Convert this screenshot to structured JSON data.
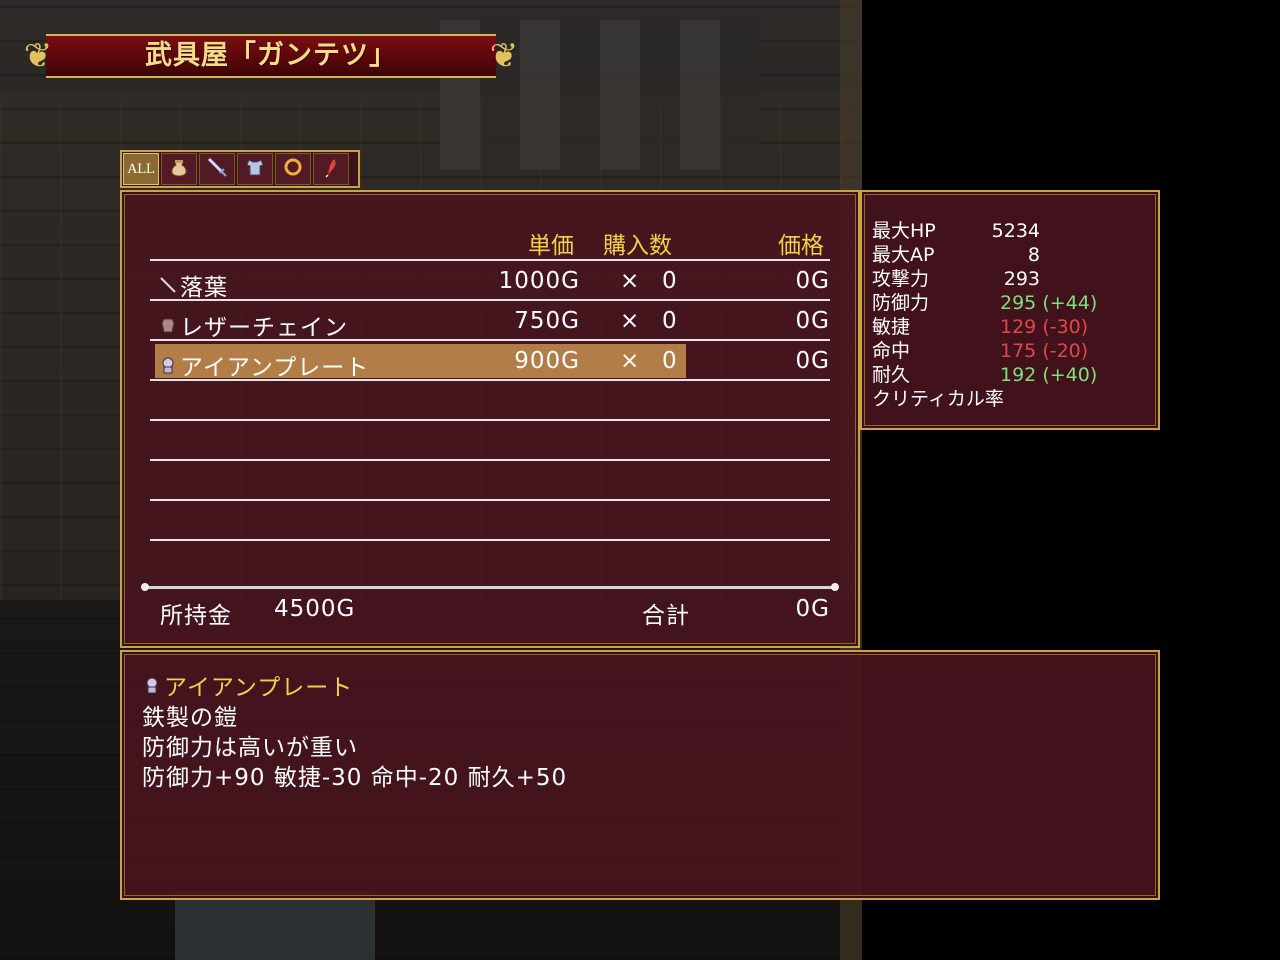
{
  "shop_title": "武具屋「ガンテツ」",
  "tabs": [
    {
      "label": "ALL",
      "icon": "all-text",
      "active": true
    },
    {
      "label": "",
      "icon": "bag-icon"
    },
    {
      "label": "",
      "icon": "sword-icon"
    },
    {
      "label": "",
      "icon": "armor-icon"
    },
    {
      "label": "",
      "icon": "ring-icon"
    },
    {
      "label": "",
      "icon": "feather-icon"
    }
  ],
  "list": {
    "headers": {
      "unit_price": "単価",
      "quantity": "購入数",
      "price": "価格"
    },
    "items": [
      {
        "icon": "sword-icon",
        "name": "落葉",
        "unit_price": "1000G",
        "times": "×",
        "qty": "0",
        "price": "0G",
        "selected": false
      },
      {
        "icon": "leather-armor-icon",
        "name": "レザーチェイン",
        "unit_price": "750G",
        "times": "×",
        "qty": "0",
        "price": "0G",
        "selected": false
      },
      {
        "icon": "plate-armor-icon",
        "name": "アイアンプレート",
        "unit_price": "900G",
        "times": "×",
        "qty": "0",
        "price": "0G",
        "selected": true
      }
    ],
    "gold_label": "所持金",
    "gold_value": "4500G",
    "total_label": "合計",
    "total_value": "0G"
  },
  "status": [
    {
      "label": "最大HP",
      "value": "5234",
      "diff": ""
    },
    {
      "label": "最大AP",
      "value": "8",
      "diff": ""
    },
    {
      "label": "攻撃力",
      "value": "293",
      "diff": ""
    },
    {
      "label": "防御力",
      "value": "295",
      "diff": "(+44)",
      "trend": "up"
    },
    {
      "label": "敏捷",
      "value": "129",
      "diff": "(-30)",
      "trend": "down"
    },
    {
      "label": "命中",
      "value": "175",
      "diff": "(-20)",
      "trend": "down"
    },
    {
      "label": "耐久",
      "value": "192",
      "diff": "(+40)",
      "trend": "up"
    },
    {
      "label": "クリティカル率",
      "value": "",
      "diff": ""
    }
  ],
  "description": {
    "icon": "plate-armor-icon",
    "name": "アイアンプレート",
    "lines": [
      "鉄製の鎧",
      "防御力は高いが重い",
      "防御力+90 敏捷-30 命中-20 耐久+50"
    ]
  },
  "colors": {
    "panel": "#48141e",
    "border": "#c9a24a",
    "highlight": "#b9834a",
    "header": "#f2d04a",
    "up": "#7ee07a",
    "down": "#e04848"
  }
}
